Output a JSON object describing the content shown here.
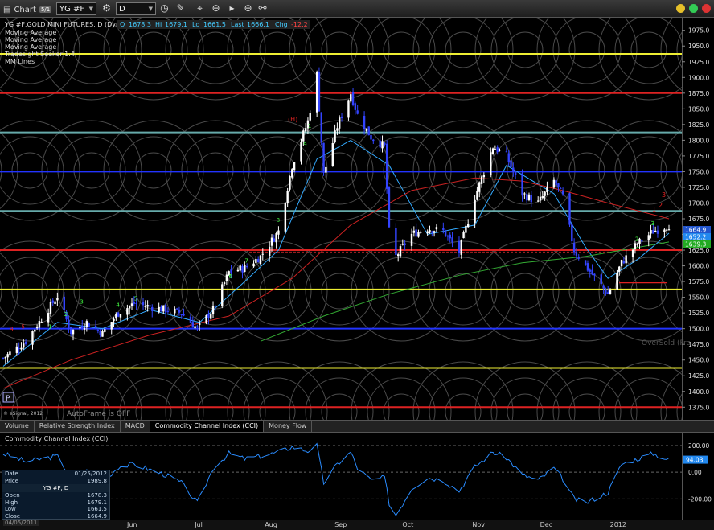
{
  "toolbar": {
    "title": "Chart",
    "title_badge": "5/1",
    "symbol": "YG #F",
    "interval": "D"
  },
  "legend": {
    "symbol_desc": "YG #F,GOLD MINI FUTURES, D (Dynamic)",
    "open_label": "O",
    "open": "1678.3",
    "high_label": "Hi",
    "high": "1679.1",
    "low_label": "Lo",
    "low": "1661.5",
    "last_label": "Last",
    "last": "1666.1",
    "chg_label": "Chg",
    "chg": "-12.2",
    "studies": [
      "Moving Average",
      "Moving Average",
      "Moving Average",
      "Tradesight Seeker 1.4",
      "MM Lines"
    ]
  },
  "annotations": {
    "esignal": "© eSignal, 2012",
    "autoframe": "AutoFrame is OFF",
    "oversold": "OverSold (Fra",
    "p_marker": "P",
    "h_marker": "(H)",
    "red_3": "3",
    "red_2": "2",
    "red_1": "1"
  },
  "tabs": [
    "Volume",
    "Relative Strength Index",
    "MACD",
    "Commodity Channel Index (CCI)",
    "Money Flow"
  ],
  "active_tab": 3,
  "cci_title": "Commodity Channel Index (CCI)",
  "info_panel": {
    "date_label": "Date",
    "date": "01/25/2012",
    "price_label": "Price",
    "price": "1989.8",
    "symbol": "YG #F, D",
    "open_label": "Open",
    "open": "1678.3",
    "high_label": "High",
    "high": "1679.1",
    "low_label": "Low",
    "low": "1661.5",
    "close_label": "Close",
    "close": "1664.9"
  },
  "timestamp": "04/05/2011",
  "x_labels": [
    "Jun",
    "Jul",
    "Aug",
    "Sep",
    "Oct",
    "Nov",
    "Dec",
    "2012"
  ],
  "price_badges": [
    {
      "value": "1664.9",
      "color": "#2255cc"
    },
    {
      "value": "1652.2",
      "color": "#2288ee"
    },
    {
      "value": "1639.3",
      "color": "#22aa22"
    }
  ],
  "cci_badge": "94.03",
  "colors": {
    "up": "#ffffff",
    "down": "#3344ff",
    "ma_fast": "#33aaff",
    "ma_mid": "#cc2222",
    "ma_slow": "#33aa33",
    "yellow": "#eeee33",
    "red": "#dd2222",
    "teal": "#66aaaa",
    "blue": "#2233ff"
  },
  "chart_data": [
    {
      "type": "candlestick",
      "title": "YG #F,GOLD MINI FUTURES, D (Dynamic)",
      "ylim": [
        1360,
        1990
      ],
      "y_ticks": [
        1975.0,
        1950.0,
        1925.0,
        1900.0,
        1875.0,
        1850.0,
        1825.0,
        1800.0,
        1775.0,
        1750.0,
        1725.0,
        1700.0,
        1675.0,
        1650.0,
        1625.0,
        1600.0,
        1575.0,
        1550.0,
        1525.0,
        1500.0,
        1475.0,
        1450.0,
        1425.0,
        1400.0,
        1375.0
      ],
      "x_labels": [
        "Jun",
        "Jul",
        "Aug",
        "Sep",
        "Oct",
        "Nov",
        "Dec",
        "2012"
      ],
      "start": "2011-04-05",
      "end": "2012-01-25",
      "horizontal_levels": [
        {
          "price": 1937.5,
          "color": "yellow"
        },
        {
          "price": 1875.0,
          "color": "red"
        },
        {
          "price": 1812.5,
          "color": "teal"
        },
        {
          "price": 1750.0,
          "color": "blue"
        },
        {
          "price": 1687.5,
          "color": "teal"
        },
        {
          "price": 1625.0,
          "color": "red"
        },
        {
          "price": 1562.5,
          "color": "yellow"
        },
        {
          "price": 1500.0,
          "color": "blue"
        },
        {
          "price": 1437.5,
          "color": "yellow"
        },
        {
          "price": 1375.0,
          "color": "red"
        }
      ],
      "close_path": [
        [
          "2011-04-05",
          1453
        ],
        [
          "2011-04-15",
          1480
        ],
        [
          "2011-04-29",
          1552
        ],
        [
          "2011-05-05",
          1495
        ],
        [
          "2011-05-12",
          1510
        ],
        [
          "2011-05-19",
          1493
        ],
        [
          "2011-05-26",
          1525
        ],
        [
          "2011-06-02",
          1540
        ],
        [
          "2011-06-09",
          1535
        ],
        [
          "2011-06-16",
          1530
        ],
        [
          "2011-06-23",
          1525
        ],
        [
          "2011-06-30",
          1500
        ],
        [
          "2011-07-07",
          1530
        ],
        [
          "2011-07-14",
          1590
        ],
        [
          "2011-07-21",
          1597
        ],
        [
          "2011-07-28",
          1615
        ],
        [
          "2011-08-05",
          1655
        ],
        [
          "2011-08-11",
          1760
        ],
        [
          "2011-08-18",
          1830
        ],
        [
          "2011-08-22",
          1905
        ],
        [
          "2011-08-25",
          1745
        ],
        [
          "2011-08-31",
          1822
        ],
        [
          "2011-09-06",
          1875
        ],
        [
          "2011-09-09",
          1840
        ],
        [
          "2011-09-15",
          1805
        ],
        [
          "2011-09-21",
          1790
        ],
        [
          "2011-09-23",
          1655
        ],
        [
          "2011-09-26",
          1615
        ],
        [
          "2011-10-03",
          1650
        ],
        [
          "2011-10-10",
          1660
        ],
        [
          "2011-10-17",
          1655
        ],
        [
          "2011-10-24",
          1622
        ],
        [
          "2011-10-31",
          1710
        ],
        [
          "2011-11-08",
          1790
        ],
        [
          "2011-11-14",
          1775
        ],
        [
          "2011-11-21",
          1715
        ],
        [
          "2011-11-28",
          1700
        ],
        [
          "2011-12-05",
          1735
        ],
        [
          "2011-12-09",
          1710
        ],
        [
          "2011-12-14",
          1625
        ],
        [
          "2011-12-19",
          1600
        ],
        [
          "2011-12-29",
          1555
        ],
        [
          "2012-01-04",
          1605
        ],
        [
          "2012-01-11",
          1635
        ],
        [
          "2012-01-18",
          1655
        ],
        [
          "2012-01-25",
          1665
        ]
      ],
      "series": [
        {
          "color": "ma_fast",
          "values": [
            [
              "2011-04-05",
              1440
            ],
            [
              "2011-04-29",
              1510
            ],
            [
              "2011-05-19",
              1500
            ],
            [
              "2011-06-09",
              1530
            ],
            [
              "2011-07-01",
              1510
            ],
            [
              "2011-07-21",
              1575
            ],
            [
              "2011-08-05",
              1625
            ],
            [
              "2011-08-22",
              1770
            ],
            [
              "2011-09-06",
              1800
            ],
            [
              "2011-09-23",
              1760
            ],
            [
              "2011-10-10",
              1650
            ],
            [
              "2011-10-31",
              1665
            ],
            [
              "2011-11-14",
              1760
            ],
            [
              "2011-12-05",
              1715
            ],
            [
              "2011-12-19",
              1630
            ],
            [
              "2011-12-29",
              1580
            ],
            [
              "2012-01-11",
              1610
            ],
            [
              "2012-01-25",
              1652
            ]
          ]
        },
        {
          "color": "ma_mid",
          "values": [
            [
              "2011-04-05",
              1405
            ],
            [
              "2011-05-05",
              1450
            ],
            [
              "2011-06-09",
              1490
            ],
            [
              "2011-07-14",
              1520
            ],
            [
              "2011-08-11",
              1580
            ],
            [
              "2011-09-06",
              1665
            ],
            [
              "2011-10-03",
              1720
            ],
            [
              "2011-10-31",
              1740
            ],
            [
              "2011-11-21",
              1735
            ],
            [
              "2011-12-09",
              1720
            ],
            [
              "2011-12-29",
              1700
            ],
            [
              "2012-01-25",
              1675
            ]
          ]
        },
        {
          "color": "ma_slow",
          "values": [
            [
              "2011-07-28",
              1480
            ],
            [
              "2011-08-25",
              1520
            ],
            [
              "2011-09-23",
              1555
            ],
            [
              "2011-10-24",
              1585
            ],
            [
              "2011-11-21",
              1605
            ],
            [
              "2011-12-19",
              1615
            ],
            [
              "2012-01-25",
              1638
            ]
          ]
        }
      ]
    },
    {
      "type": "line",
      "title": "Commodity Channel Index (CCI)",
      "ylim": [
        -330,
        260
      ],
      "y_ticks": [
        200.0,
        0.0,
        -200.0
      ],
      "values": [
        [
          "2011-04-05",
          140
        ],
        [
          "2011-04-15",
          80
        ],
        [
          "2011-04-29",
          120
        ],
        [
          "2011-05-05",
          -40
        ],
        [
          "2011-05-12",
          10
        ],
        [
          "2011-05-19",
          -70
        ],
        [
          "2011-05-26",
          40
        ],
        [
          "2011-06-02",
          60
        ],
        [
          "2011-06-09",
          20
        ],
        [
          "2011-06-16",
          -20
        ],
        [
          "2011-06-23",
          -80
        ],
        [
          "2011-06-30",
          -230
        ],
        [
          "2011-07-07",
          30
        ],
        [
          "2011-07-14",
          140
        ],
        [
          "2011-07-21",
          100
        ],
        [
          "2011-07-28",
          120
        ],
        [
          "2011-08-05",
          150
        ],
        [
          "2011-08-11",
          190
        ],
        [
          "2011-08-18",
          160
        ],
        [
          "2011-08-22",
          200
        ],
        [
          "2011-08-25",
          -80
        ],
        [
          "2011-08-31",
          60
        ],
        [
          "2011-09-06",
          150
        ],
        [
          "2011-09-09",
          30
        ],
        [
          "2011-09-15",
          -60
        ],
        [
          "2011-09-21",
          -40
        ],
        [
          "2011-09-23",
          -230
        ],
        [
          "2011-09-26",
          -320
        ],
        [
          "2011-10-03",
          -120
        ],
        [
          "2011-10-10",
          -40
        ],
        [
          "2011-10-17",
          -60
        ],
        [
          "2011-10-24",
          -140
        ],
        [
          "2011-10-31",
          40
        ],
        [
          "2011-11-08",
          150
        ],
        [
          "2011-11-14",
          110
        ],
        [
          "2011-11-21",
          -20
        ],
        [
          "2011-11-28",
          -60
        ],
        [
          "2011-12-05",
          30
        ],
        [
          "2011-12-09",
          -50
        ],
        [
          "2011-12-14",
          -200
        ],
        [
          "2011-12-19",
          -230
        ],
        [
          "2011-12-29",
          -150
        ],
        [
          "2012-01-04",
          60
        ],
        [
          "2012-01-11",
          100
        ],
        [
          "2012-01-18",
          140
        ],
        [
          "2012-01-25",
          94
        ]
      ]
    }
  ]
}
